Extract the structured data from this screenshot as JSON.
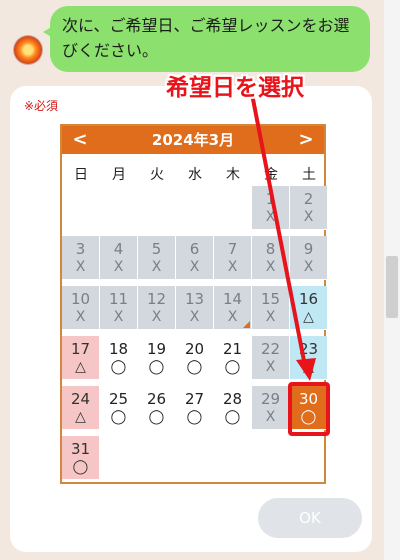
{
  "message": {
    "text": "次に、ご希望日、ご希望レッスンをお選びください。"
  },
  "form": {
    "required_label": "※必須",
    "ok_label": "OK"
  },
  "calendar": {
    "title": "2024年3月",
    "prev_label": "<",
    "next_label": ">",
    "weekdays": [
      "日",
      "月",
      "火",
      "水",
      "木",
      "金",
      "土"
    ],
    "days": [
      {
        "day": "1",
        "mark": "X"
      },
      {
        "day": "2",
        "mark": "X"
      },
      {
        "day": "3",
        "mark": "X"
      },
      {
        "day": "4",
        "mark": "X"
      },
      {
        "day": "5",
        "mark": "X"
      },
      {
        "day": "6",
        "mark": "X"
      },
      {
        "day": "7",
        "mark": "X"
      },
      {
        "day": "8",
        "mark": "X"
      },
      {
        "day": "9",
        "mark": "X"
      },
      {
        "day": "10",
        "mark": "X"
      },
      {
        "day": "11",
        "mark": "X"
      },
      {
        "day": "12",
        "mark": "X"
      },
      {
        "day": "13",
        "mark": "X"
      },
      {
        "day": "14",
        "mark": "X"
      },
      {
        "day": "15",
        "mark": "X"
      },
      {
        "day": "16",
        "mark": "△"
      },
      {
        "day": "17",
        "mark": "△"
      },
      {
        "day": "18",
        "mark": "◯"
      },
      {
        "day": "19",
        "mark": "◯"
      },
      {
        "day": "20",
        "mark": "◯"
      },
      {
        "day": "21",
        "mark": "◯"
      },
      {
        "day": "22",
        "mark": "X"
      },
      {
        "day": "23",
        "mark": "△"
      },
      {
        "day": "24",
        "mark": "△"
      },
      {
        "day": "25",
        "mark": "◯"
      },
      {
        "day": "26",
        "mark": "◯"
      },
      {
        "day": "27",
        "mark": "◯"
      },
      {
        "day": "28",
        "mark": "◯"
      },
      {
        "day": "29",
        "mark": "X"
      },
      {
        "day": "30",
        "mark": "◯"
      },
      {
        "day": "31",
        "mark": "◯"
      }
    ],
    "selected_day": "30"
  },
  "annotation": {
    "text": "希望日を選択"
  },
  "colors": {
    "accent": "#e06d1c",
    "annotation": "#e8141c",
    "bubble": "#8be06e"
  }
}
